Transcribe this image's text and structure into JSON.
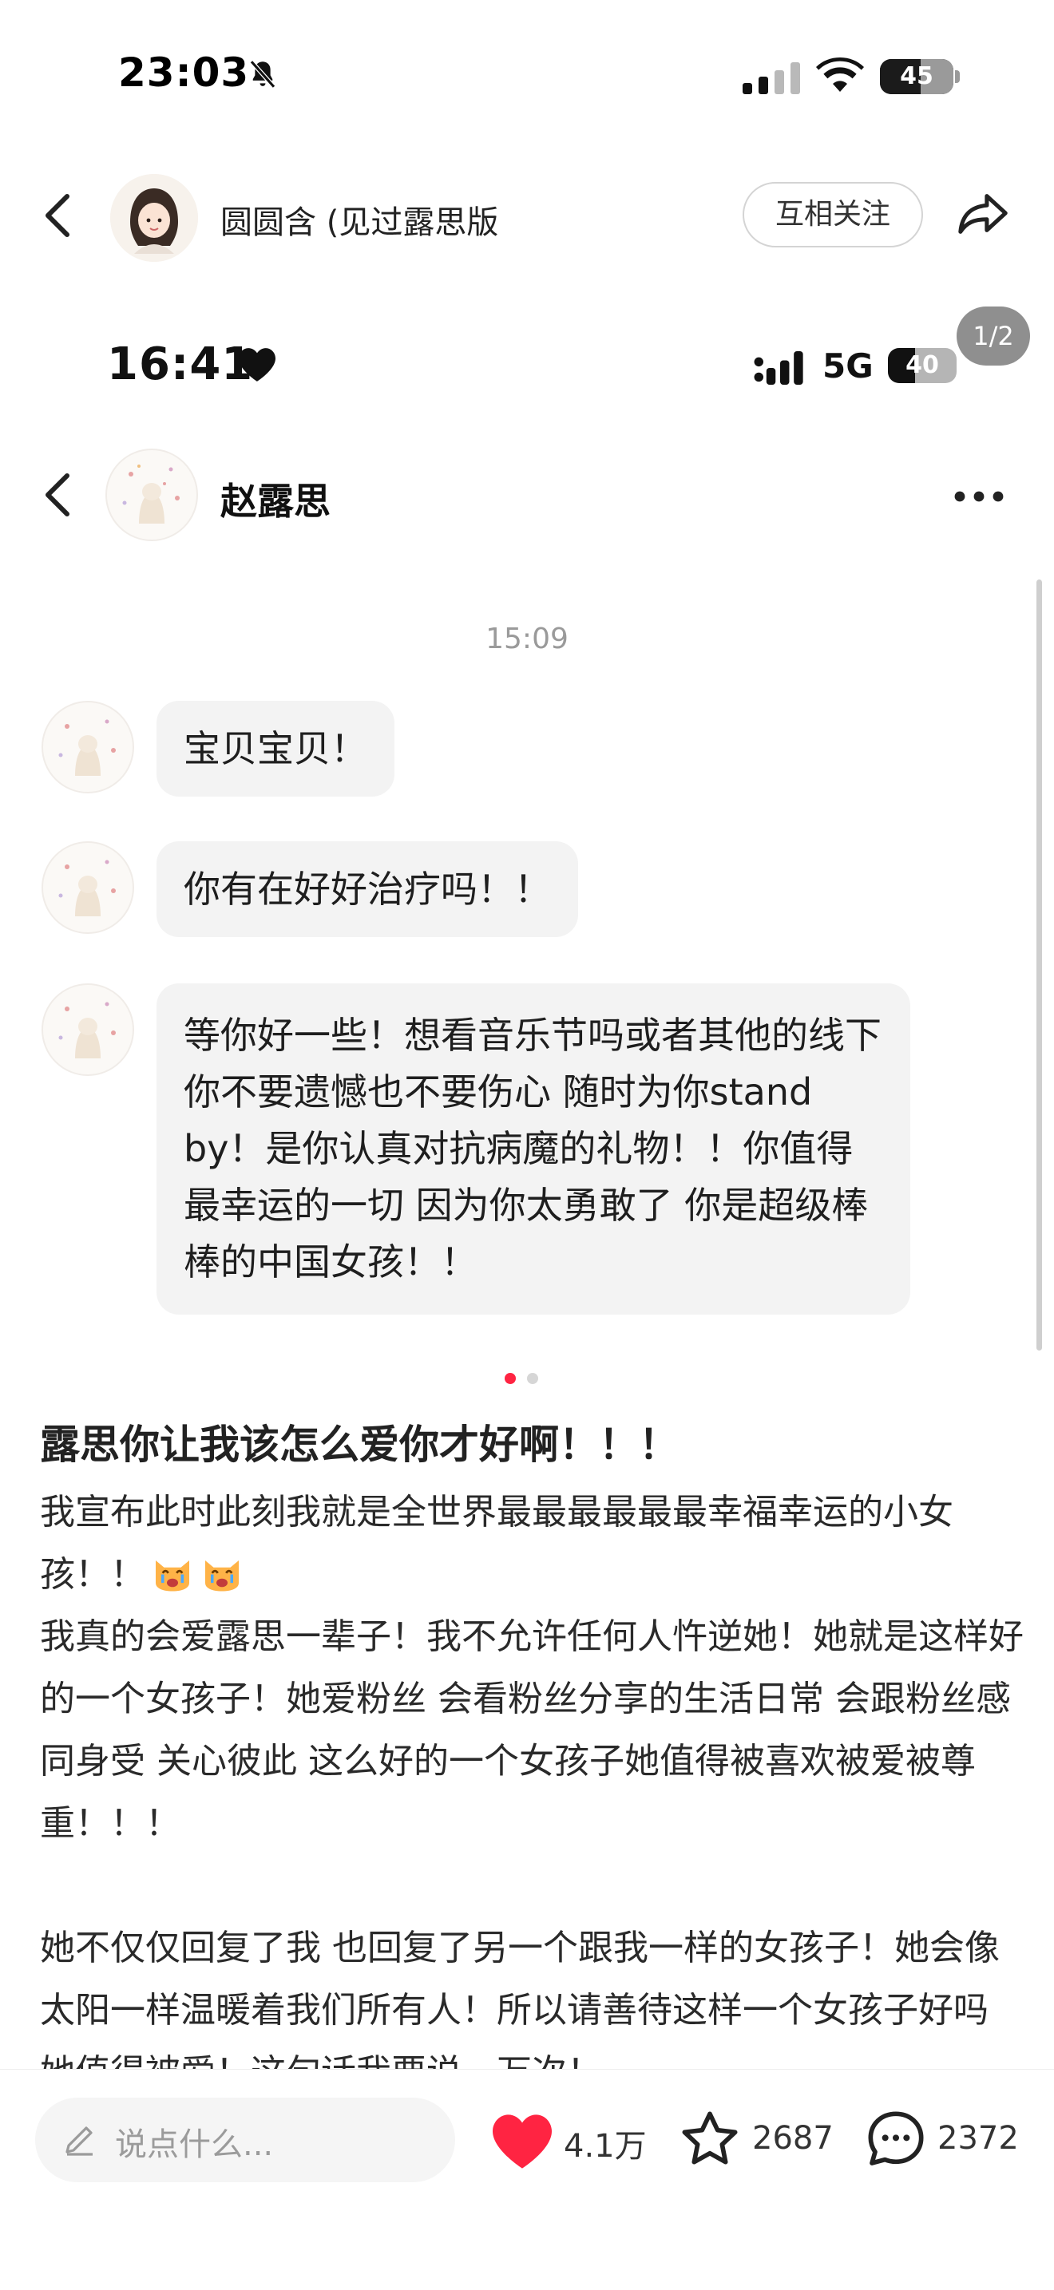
{
  "status_bar": {
    "time": "23:03",
    "battery": "45"
  },
  "nav": {
    "author": "圆圆含 (见过露思版",
    "follow_label": "互相关注"
  },
  "image_counter": "1/2",
  "screenshot": {
    "status_time": "16:41",
    "network": "5G",
    "battery": "40",
    "chat_name": "赵露思",
    "chat_time": "15:09",
    "messages": [
      "宝贝宝贝！",
      "你有在好好治疗吗！！",
      "等你好一些！想看音乐节吗或者其他的线下 你不要遗憾也不要伤心 随时为你stand by！是你认真对抗病魔的礼物！！你值得最幸运的一切 因为你太勇敢了 你是超级棒棒的中国女孩！！"
    ]
  },
  "post": {
    "title": "露思你让我该怎么爱你才好啊！！！",
    "paragraphs": [
      "我宣布此时此刻我就是全世界最最最最最最幸福幸运的小女孩！！",
      "我真的会爱露思一辈子！我不允许任何人忤逆她！她就是这样好的一个女孩子！她爱粉丝 会看粉丝分享的生活日常 会跟粉丝感同身受 关心彼此 这么好的一个女孩子她值得被喜欢被爱被尊重！！！",
      "",
      "她不仅仅回复了我 也回复了另一个跟我一样的女孩子！她会像太阳一样温暖着我们所有人！所以请善待这样一个女孩子好吗 她值得被爱！这句话我要说一万次！"
    ]
  },
  "bottom_bar": {
    "comment_placeholder": "说点什么...",
    "likes": "4.1万",
    "stars": "2687",
    "comments": "2372"
  },
  "colors": {
    "accent": "#ff2442",
    "bubble": "#f3f3f3",
    "heart": "#ff2442"
  }
}
